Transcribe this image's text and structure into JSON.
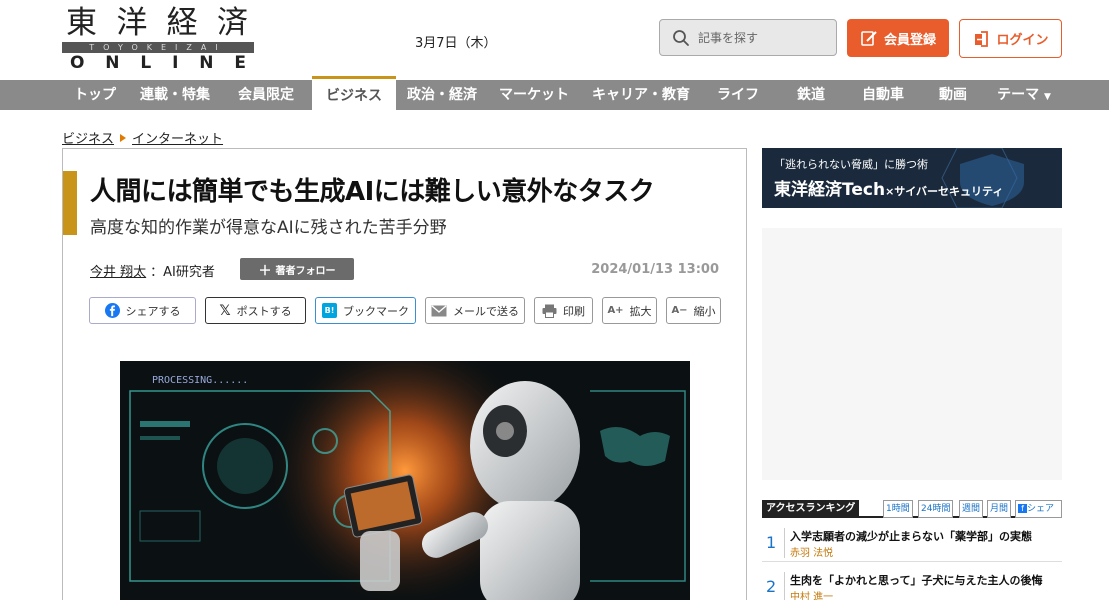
{
  "header": {
    "logo_kanji": [
      "東",
      "洋",
      "経",
      "済"
    ],
    "logo_romaji": "TOYOKEIZAI",
    "logo_online": [
      "O",
      "N",
      "L",
      "I",
      "N",
      "E"
    ],
    "date": "3月7日（木）",
    "search_placeholder": "記事を探す",
    "register_label": "会員登録",
    "login_label": "ログイン",
    "accent_color": "#e85d2b"
  },
  "nav": {
    "items": [
      "トップ",
      "連載・特集",
      "会員限定",
      "ビジネス",
      "政治・経済",
      "マーケット",
      "キャリア・教育",
      "ライフ",
      "鉄道",
      "自動車",
      "動画",
      "テーマ"
    ],
    "active": "ビジネス",
    "more_icon": "caret-down-icon"
  },
  "breadcrumb": [
    "ビジネス",
    "インターネット"
  ],
  "article": {
    "title": "人間には簡単でも生成AIには難しい意外なタスク",
    "subtitle": "高度な知的作業が得意なAIに残された苦手分野",
    "author_name": "今井 翔太",
    "author_role": "：AI研究者",
    "follow_label": "著者フォロー",
    "published": "2024/01/13 13:00",
    "share_buttons": [
      {
        "label": "シェアする",
        "icon": "facebook-icon"
      },
      {
        "label": "ポストする",
        "icon": "x-icon"
      },
      {
        "label": "ブックマーク",
        "icon": "hatena-bookmark-icon"
      },
      {
        "label": "メールで送る",
        "icon": "mail-icon"
      },
      {
        "label": "印刷",
        "icon": "print-icon"
      },
      {
        "label": "拡大",
        "icon": "zoom-in-icon"
      },
      {
        "label": "縮小",
        "icon": "zoom-out-icon"
      }
    ],
    "hero_text": "PROCESSING......",
    "accent_color": "#c8941a"
  },
  "sidebar": {
    "banner_line1": "「逃れられない脅威」に勝つ術",
    "banner_line2_main": "東洋経済Tech",
    "banner_line2_sub": "×サイバーセキュリティ",
    "ranking": {
      "title": "アクセスランキング",
      "tabs": [
        "1時間",
        "24時間",
        "週間",
        "月間"
      ],
      "share_label": "シェア",
      "items": [
        {
          "rank": "1",
          "title": "入学志願者の減少が止まらない「薬学部」の実態",
          "author": "赤羽 法悦"
        },
        {
          "rank": "2",
          "title": "生肉を「よかれと思って」子犬に与えた主人の後悔",
          "author": "中村 進一"
        }
      ]
    }
  }
}
